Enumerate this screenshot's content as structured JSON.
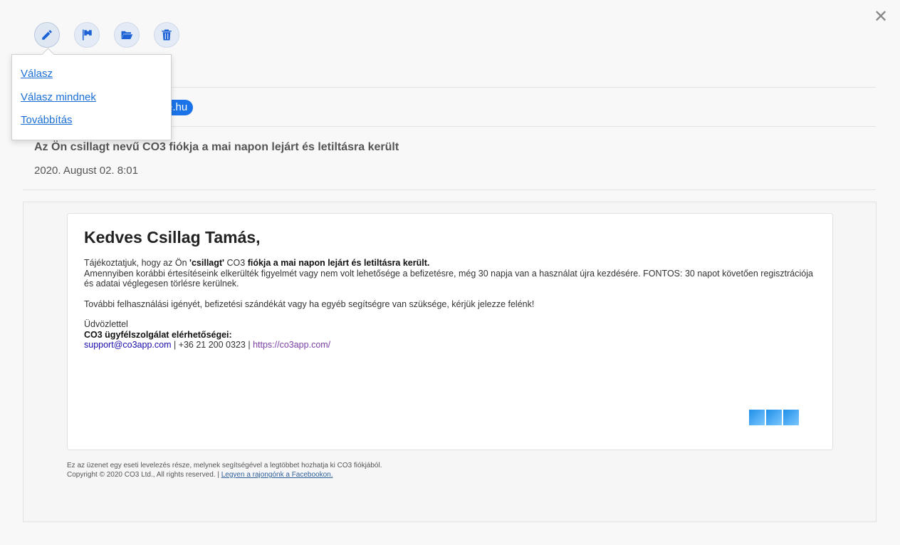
{
  "window": {
    "close_glyph": "✕"
  },
  "toolbar": {
    "buttons": [
      {
        "name": "reply-button",
        "icon": "pencil-icon"
      },
      {
        "name": "flag-button",
        "icon": "flag-icon"
      },
      {
        "name": "move-folder-button",
        "icon": "folder-open-icon"
      },
      {
        "name": "delete-button",
        "icon": "trash-icon"
      }
    ]
  },
  "reply_menu": {
    "items": [
      "Válasz",
      "Válasz mindnek",
      "Továbbítás"
    ]
  },
  "message": {
    "sender_fragment": "e.hu",
    "subject": "Az Ön csillagt nevű CO3 fiókja a mai napon lejárt és letiltásra került",
    "date": "2020. August 02. 8:01"
  },
  "mail_body": {
    "greeting": "Kedves Csillag Tamás,",
    "p1_a": "Tájékoztatjuk, hogy az Ön ",
    "p1_b": "'csillagt'",
    "p1_c": " CO3 ",
    "p1_d": "fiókja a mai napon lejárt és letiltásra került.",
    "p1_line2": "Amennyiben korábbi értesítéseink elkerülték figyelmét vagy nem volt lehetősége a befizetésre, még 30 napja van a használat újra kezdésére. FONTOS: 30 napot követően regisztrációja és adatai véglegesen törlésre kerülnek.",
    "p2": "További felhasználási igényét, befizetési szándékát vagy ha egyéb segítségre van szüksége, kérjük jelezze felénk!",
    "signoff": "Üdvözlettel",
    "contact_title": "CO3 ügyfélszolgálat elérhetőségei:",
    "email": "support@co3app.com",
    "sep1": " | +36 21 200 0323 | ",
    "website": "https://co3app.com/"
  },
  "footer": {
    "line1": "Ez az üzenet egy eseti levelezés része, melynek segítségével a legtöbbet hozhatja ki CO3 fiókjából.",
    "line2": "Copyright © 2020 CO3 Ltd., All rights reserved. | ",
    "facebook_link": "Legyen a rajongónk a Facebookon."
  },
  "colors": {
    "accent": "#1a73e8",
    "link": "#1a0dab"
  }
}
